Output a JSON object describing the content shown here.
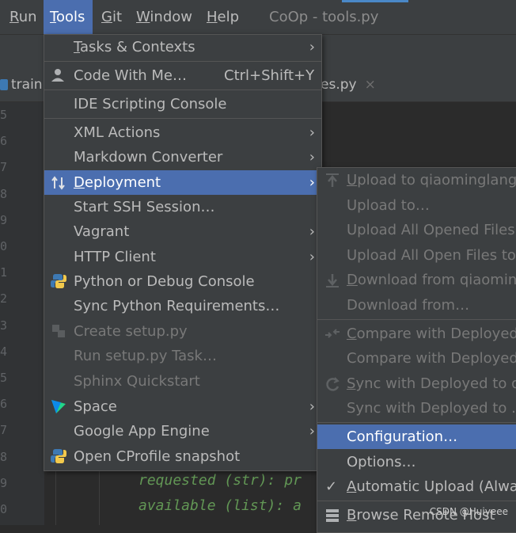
{
  "menubar": {
    "items": [
      {
        "mn": "R",
        "rest": "un"
      },
      {
        "mn": "T",
        "rest": "ools"
      },
      {
        "mn": "G",
        "rest": "it"
      },
      {
        "mn": "W",
        "rest": "indow"
      },
      {
        "mn": "H",
        "rest": "elp"
      }
    ],
    "title": "CoOp - tools.py"
  },
  "tabs": {
    "left": "train.",
    "right": "es.py",
    "close": "×"
  },
  "gutter_lines": [
    "5",
    "6",
    "7",
    "8",
    "9",
    "0",
    "1",
    "2",
    "3",
    "4",
    "5",
    "6",
    "7",
    "8",
    "9",
    "0"
  ],
  "code_lines": [
    "requested (str): pr",
    "available (list): a"
  ],
  "tools_menu": {
    "items": [
      {
        "pre": "",
        "mn": "T",
        "post": "asks & Contexts",
        "arrow": "›"
      },
      {
        "pre": "Code With Me…",
        "mn": "",
        "post": "",
        "shortcut": "Ctrl+Shift+Y",
        "icon": "user-icon"
      },
      {
        "pre": "IDE Scripting Console",
        "mn": "",
        "post": ""
      },
      {
        "pre": "XML Actions",
        "mn": "",
        "post": "",
        "arrow": "›"
      },
      {
        "pre": "Markdown Converter",
        "mn": "",
        "post": "",
        "arrow": "›"
      },
      {
        "pre": "",
        "mn": "D",
        "post": "eployment",
        "arrow": "›",
        "icon": "deployment-icon"
      },
      {
        "pre": "Start SSH Session…",
        "mn": "",
        "post": ""
      },
      {
        "pre": "Vagrant",
        "mn": "",
        "post": "",
        "arrow": "›"
      },
      {
        "pre": "HTTP Client",
        "mn": "",
        "post": "",
        "arrow": "›"
      },
      {
        "pre": "Python or Debug Console",
        "mn": "",
        "post": "",
        "icon": "python-icon"
      },
      {
        "pre": "Sync Python Requirements…",
        "mn": "",
        "post": ""
      },
      {
        "pre": "Create setup.py",
        "mn": "",
        "post": "",
        "icon": "setup-icon"
      },
      {
        "pre": "Run setup.py Task…",
        "mn": "",
        "post": ""
      },
      {
        "pre": "Sphinx Quickstart",
        "mn": "",
        "post": ""
      },
      {
        "pre": "Space",
        "mn": "",
        "post": "",
        "arrow": "›",
        "icon": "space-icon"
      },
      {
        "pre": "Google App Engine",
        "mn": "",
        "post": "",
        "arrow": "›"
      },
      {
        "pre": "Open CProfile snapshot",
        "mn": "",
        "post": "",
        "icon": "python-icon"
      }
    ]
  },
  "deployment_menu": {
    "items": [
      {
        "pre": "",
        "mn": "U",
        "post": "pload to qiaominglang"
      },
      {
        "pre": "Upload to…",
        "mn": "",
        "post": ""
      },
      {
        "pre": "Upload All Opened Files",
        "mn": "",
        "post": ""
      },
      {
        "pre": "Upload All Open Files to.",
        "mn": "",
        "post": ""
      },
      {
        "pre": "",
        "mn": "D",
        "post": "ownload from qiaominc"
      },
      {
        "pre": "Download from…",
        "mn": "",
        "post": ""
      },
      {
        "pre": "",
        "mn": "C",
        "post": "ompare with Deployed"
      },
      {
        "pre": "Compare with Deployed",
        "mn": "",
        "post": ""
      },
      {
        "pre": "",
        "mn": "S",
        "post": "ync with Deployed to qi"
      },
      {
        "pre": "Sync with Deployed to …",
        "mn": "",
        "post": ""
      },
      {
        "pre": "Configuration…",
        "mn": "",
        "post": ""
      },
      {
        "pre": "Options…",
        "mn": "",
        "post": ""
      },
      {
        "pre": "",
        "mn": "A",
        "post": "utomatic Upload (Alway",
        "check": "✓"
      },
      {
        "pre": "",
        "mn": "B",
        "post": "rowse Remote Host"
      }
    ]
  },
  "watermark": "CSDN @Huiyeee",
  "colors": {
    "selection": "#4b6eaf",
    "menu_bg": "#3c3f41",
    "editor_bg": "#2b2b2b",
    "doc_green": "#629755"
  }
}
